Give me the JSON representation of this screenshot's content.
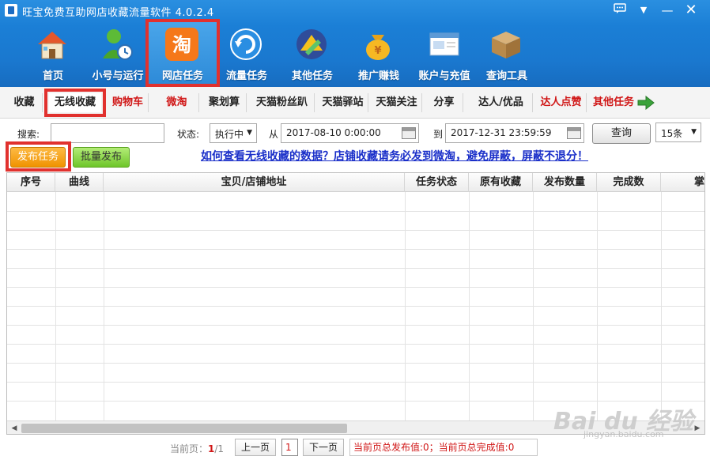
{
  "app": {
    "title": "旺宝免费互助网店收藏流量软件 4.0.2.4"
  },
  "toolbar": {
    "items": [
      {
        "label": "首页",
        "icon": "home-icon"
      },
      {
        "label": "小号与运行",
        "icon": "user-run-icon"
      },
      {
        "label": "网店任务",
        "icon": "taobao-icon"
      },
      {
        "label": "流量任务",
        "icon": "refresh-icon"
      },
      {
        "label": "其他任务",
        "icon": "tasks-icon"
      },
      {
        "label": "推广赚钱",
        "icon": "money-bag-icon"
      },
      {
        "label": "账户与充值",
        "icon": "account-icon"
      },
      {
        "label": "查询工具",
        "icon": "box-icon"
      }
    ],
    "active_index": 2
  },
  "subtabs": {
    "items": [
      {
        "label": "收藏"
      },
      {
        "label": "无线收藏"
      },
      {
        "label": "购物车"
      },
      {
        "label": "微淘"
      },
      {
        "label": "聚划算"
      },
      {
        "label": "天猫粉丝趴"
      },
      {
        "label": "天猫驿站"
      },
      {
        "label": "天猫关注"
      },
      {
        "label": "分享"
      },
      {
        "label": "达人/优品"
      },
      {
        "label": "达人点赞"
      },
      {
        "label": "其他任务"
      }
    ],
    "active_index": 1
  },
  "filters": {
    "search_label": "搜索:",
    "search_value": "",
    "status_label": "状态:",
    "status_value": "执行中",
    "from_label": "从",
    "from_value": "2017-08-10 0:00:00",
    "to_label": "到",
    "to_value": "2017-12-31 23:59:59",
    "query_label": "查询",
    "page_size_value": "15条"
  },
  "actions": {
    "publish_label": "发布任务",
    "batch_label": "批量发布",
    "notice_text": "如何查看无线收藏的数据？店铺收藏请务必发到微淘，避免屏蔽，屏蔽不退分！"
  },
  "table": {
    "columns": [
      "序号",
      "曲线",
      "宝贝/店铺地址",
      "任务状态",
      "原有收藏",
      "发布数量",
      "完成数",
      "掌"
    ],
    "rows": []
  },
  "pager": {
    "current_label": "当前页：",
    "current_page": "1",
    "total_pages": "/1",
    "prev_label": "上一页",
    "page_box": "1",
    "next_label": "下一页",
    "summary": "当前页总发布值:0；当前页总完成值:0"
  },
  "watermark": {
    "main": "Bai du 经验",
    "sub": "jingyan.baidu.com"
  },
  "colors": {
    "titlebar": "#1b7fd6",
    "highlight_frame": "#e1312e",
    "red_text": "#d01616",
    "link": "#1a2fc9"
  }
}
